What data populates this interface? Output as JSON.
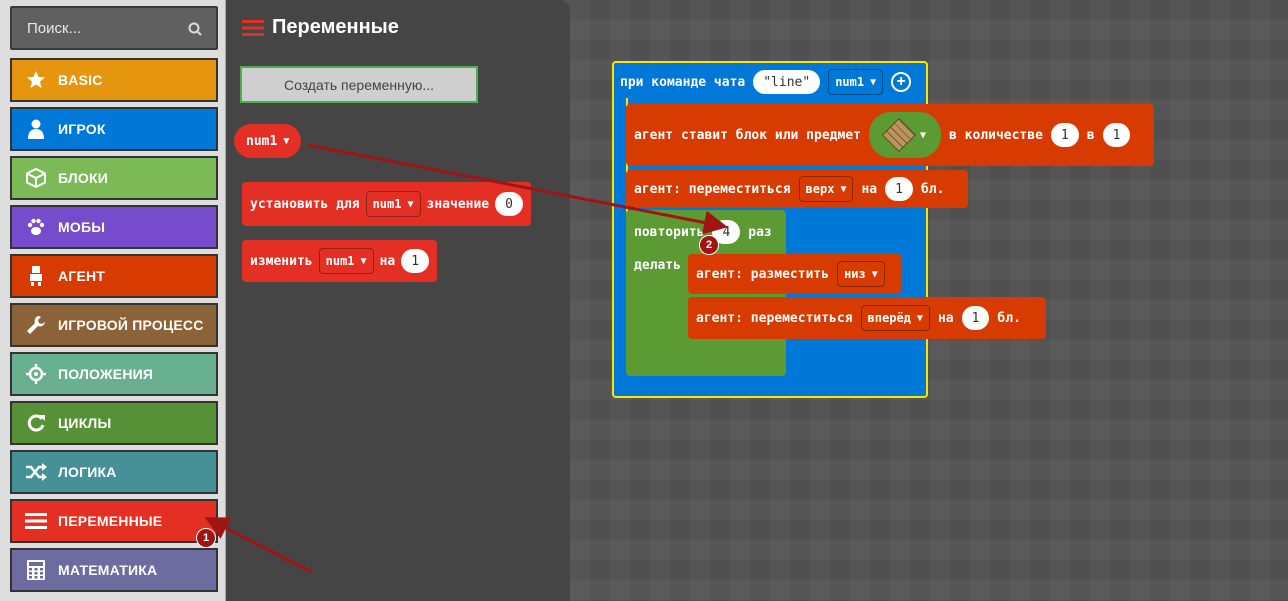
{
  "search": {
    "placeholder": "Поиск..."
  },
  "categories": [
    {
      "label": "BASIC",
      "color": "#e5960e",
      "icon": "star-icon"
    },
    {
      "label": "ИГРОК",
      "color": "#0078d7",
      "icon": "person-icon"
    },
    {
      "label": "БЛОКИ",
      "color": "#7cba58",
      "icon": "cube-icon"
    },
    {
      "label": "МОБЫ",
      "color": "#764bcc",
      "icon": "paw-icon"
    },
    {
      "label": "АГЕНТ",
      "color": "#d83b01",
      "icon": "agent-icon"
    },
    {
      "label": "ИГРОВОЙ ПРОЦЕСС",
      "color": "#8c6239",
      "icon": "wrench-icon"
    },
    {
      "label": "ПОЛОЖЕНИЯ",
      "color": "#69b090",
      "icon": "crosshair-icon"
    },
    {
      "label": "ЦИКЛЫ",
      "color": "#569138",
      "icon": "loop-icon"
    },
    {
      "label": "ЛОГИКА",
      "color": "#459197",
      "icon": "shuffle-icon"
    },
    {
      "label": "ПЕРЕМЕННЫЕ",
      "color": "#e42f25",
      "icon": "list-icon"
    },
    {
      "label": "МАТЕМАТИКА",
      "color": "#6c6ca0",
      "icon": "calculator-icon"
    }
  ],
  "flyout": {
    "title": "Переменные",
    "create_button": "Создать переменную...",
    "var_reporter": "num1",
    "set_block": {
      "text1": "установить для",
      "var": "num1",
      "text2": "значение",
      "value": "0"
    },
    "change_block": {
      "text1": "изменить",
      "var": "num1",
      "text2": "на",
      "value": "1"
    }
  },
  "workspace": {
    "event": {
      "text": "при команде чата",
      "command": "\"line\"",
      "var": "num1"
    },
    "place_block": {
      "text1": "агент ставит блок или предмет",
      "text2": "в количестве",
      "amount": "1",
      "text3": "в",
      "slot": "1"
    },
    "move_up": {
      "text1": "агент: переместиться",
      "dir": "верх",
      "text2": "на",
      "value": "1",
      "text3": "бл."
    },
    "repeat": {
      "text1": "повторить",
      "times": "4",
      "text2": "раз",
      "do": "делать"
    },
    "place_down": {
      "text1": "агент: разместить",
      "dir": "низ"
    },
    "move_fwd": {
      "text1": "агент: переместиться",
      "dir": "вперёд",
      "text2": "на",
      "value": "1",
      "text3": "бл."
    }
  },
  "annotations": {
    "badge1": "1",
    "badge2": "2"
  }
}
